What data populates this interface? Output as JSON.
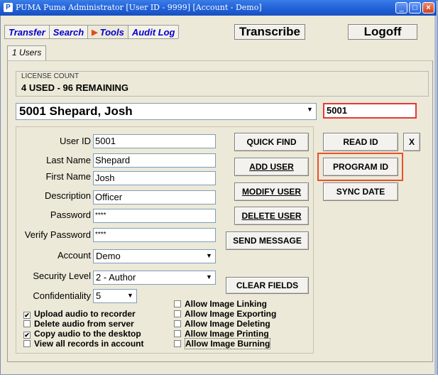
{
  "window": {
    "title": "PUMA  Puma Administrator [User ID - 9999] [Account - Demo]",
    "icon": "app-icon"
  },
  "tabs": [
    {
      "label": "Transfer"
    },
    {
      "label": "Search"
    },
    {
      "label": "Tools",
      "icon": "triangle-right-icon"
    },
    {
      "label": "Audit Log"
    }
  ],
  "top_buttons": {
    "transcribe": "Transcribe",
    "logoff": "Logoff"
  },
  "subtab": {
    "label": "1 Users"
  },
  "license": {
    "label": "LICENSE COUNT",
    "value": "4 USED - 96 REMAINING"
  },
  "user_select": {
    "value": "5001  Shepard, Josh"
  },
  "user_id_box": {
    "value": "5001"
  },
  "form": {
    "user_id": {
      "label": "User ID",
      "value": "5001"
    },
    "last_name": {
      "label": "Last Name",
      "value": "Shepard"
    },
    "first_name": {
      "label": "First Name",
      "value": "Josh"
    },
    "description": {
      "label": "Description",
      "value": "Officer"
    },
    "password": {
      "label": "Password",
      "value": "****"
    },
    "verify_password": {
      "label": "Verify Password",
      "value": "****"
    },
    "account": {
      "label": "Account",
      "value": "Demo"
    },
    "security_level": {
      "label": "Security Level",
      "value": "2 - Author"
    },
    "confidentiality": {
      "label": "Confidentiality",
      "value": "5"
    }
  },
  "action_buttons": {
    "quick_find": "QUICK FIND",
    "add_user": "ADD USER",
    "modify_user": "MODIFY USER",
    "delete_user": "DELETE USER",
    "send_message": "SEND MESSAGE",
    "clear_fields": "CLEAR FIELDS"
  },
  "device_buttons": {
    "read_id": "READ ID",
    "x": "X",
    "program_id": "PROGRAM ID",
    "sync_date": "SYNC DATE"
  },
  "checkboxes_left": [
    {
      "label": "Upload audio to recorder",
      "checked": true
    },
    {
      "label": "Delete audio from server",
      "checked": false
    },
    {
      "label": "Copy audio to the desktop",
      "checked": true
    },
    {
      "label": "View all records in account",
      "checked": false
    }
  ],
  "checkboxes_right": [
    {
      "label": "Allow Image Linking",
      "checked": false
    },
    {
      "label": "Allow Image Exporting",
      "checked": false
    },
    {
      "label": "Allow Image Deleting",
      "checked": false
    },
    {
      "label": "Allow Image Printing",
      "checked": false
    },
    {
      "label": "Allow Image Burning",
      "checked": false
    }
  ],
  "colors": {
    "titlebar": "#1f5fd6",
    "tab_text": "#0000cc",
    "highlight": "#e8502a"
  }
}
